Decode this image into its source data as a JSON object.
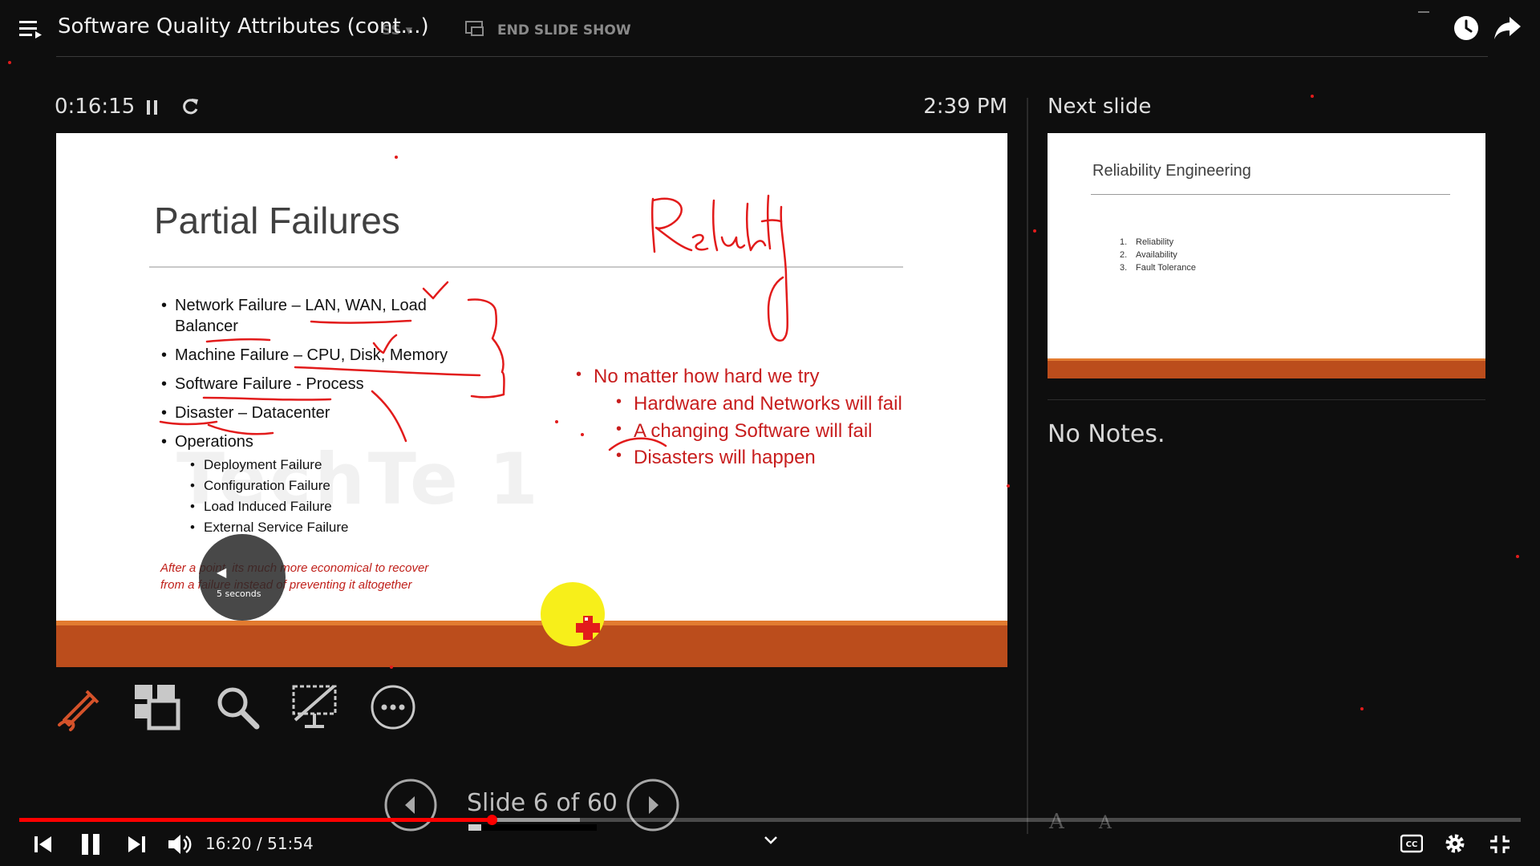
{
  "video": {
    "title": "Software Quality Attributes (cont...)",
    "current_time": "16:20",
    "duration": "51:54",
    "time_separator": " / ",
    "progress_fraction": 0.3148,
    "buffer_fraction": 0.293
  },
  "toolbar_ghost": {
    "end_slide_show": "END SLIDE SHOW",
    "settings_fragment": "SS ▾"
  },
  "presenter": {
    "timer": "0:16:15",
    "clock": "2:39 PM",
    "next_slide_label": "Next slide",
    "slide_counter": "Slide 6 of 60",
    "slide_position_fraction": 0.1,
    "notes": "No Notes."
  },
  "seek_overlay": {
    "arrow": "◀",
    "label": "5 seconds"
  },
  "current_slide": {
    "title": "Partial Failures",
    "bullets": [
      "Network Failure – LAN, WAN, Load",
      "Balancer",
      "Machine Failure – CPU, Disk, Memory",
      "Software Failure - Process",
      "Disaster – Datacenter",
      "Operations"
    ],
    "sub_bullets": [
      "Deployment Failure",
      "Configuration Failure",
      "Load Induced Failure",
      "External Service Failure"
    ],
    "italic_note_line1": "After a point, its much more economical to recover",
    "italic_note_line2": "from a failure instead of preventing it altogether",
    "red_bullets": [
      "No matter how hard we try",
      "Hardware and Networks will fail",
      "A changing Software will fail",
      "Disasters will happen"
    ]
  },
  "next_slide": {
    "title": "Reliability Engineering",
    "items": [
      {
        "num": "1.",
        "text": "Reliability"
      },
      {
        "num": "2.",
        "text": "Availability"
      },
      {
        "num": "3.",
        "text": "Fault Tolerance"
      }
    ]
  },
  "font_controls": {
    "larger": "A",
    "smaller": "A"
  },
  "colors": {
    "accent_orange": "#bb4d1c",
    "ink_red": "#e21b1b",
    "progress_red": "#ff0000",
    "laser_yellow": "#f7ef1a"
  },
  "icons": {
    "menu": "hamburger-icon",
    "watch_later": "clock-icon",
    "share": "share-arrow-icon",
    "pen": "pen-icon",
    "all_slides": "grid-icon",
    "zoom": "magnifier-icon",
    "black_screen": "monitor-off-icon",
    "more": "ellipsis-icon"
  }
}
